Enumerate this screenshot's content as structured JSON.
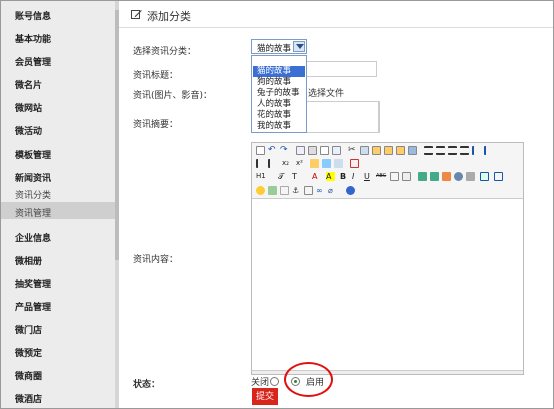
{
  "sidebar": {
    "items": [
      {
        "label": "账号信息"
      },
      {
        "label": "基本功能"
      },
      {
        "label": "会员管理"
      },
      {
        "label": "微名片"
      },
      {
        "label": "微网站"
      },
      {
        "label": "微活动"
      },
      {
        "label": "模板管理"
      },
      {
        "label": "新闻资讯"
      },
      {
        "label": "企业信息"
      },
      {
        "label": "微相册"
      },
      {
        "label": "抽奖管理"
      },
      {
        "label": "产品管理"
      },
      {
        "label": "微门店"
      },
      {
        "label": "微预定"
      },
      {
        "label": "微商圈"
      },
      {
        "label": "微酒店"
      }
    ],
    "sub_items": [
      {
        "label": "资讯分类"
      },
      {
        "label": "资讯管理"
      }
    ]
  },
  "header": {
    "title": "添加分类",
    "icon": "edit-icon"
  },
  "form": {
    "category_label": "选择资讯分类：",
    "category_selected": "猫的故事",
    "category_options": [
      "猫的故事",
      "狗的故事",
      "兔子的故事",
      "人的故事",
      "花的故事",
      "我的故事"
    ],
    "title_label": "资讯标题：",
    "media_label": "资讯(图片、影音)：",
    "choose_file": "选择文件",
    "summary_label": "资讯摘要：",
    "content_label": "资讯内容：",
    "status_label": "状态：",
    "status_off": "关闭",
    "status_on": "启用",
    "status_selected": "启用",
    "submit": "提交"
  },
  "editor": {
    "toolbar_row2": [
      "x₂",
      "x²"
    ],
    "toolbar_row3": [
      "H1",
      "𝒯",
      "T",
      "A",
      "A",
      "B",
      "I",
      "U",
      "ABC"
    ]
  },
  "colors": {
    "accent": "#d9261c",
    "highlight": "#e01010",
    "select_blue": "#3b6fd4"
  }
}
